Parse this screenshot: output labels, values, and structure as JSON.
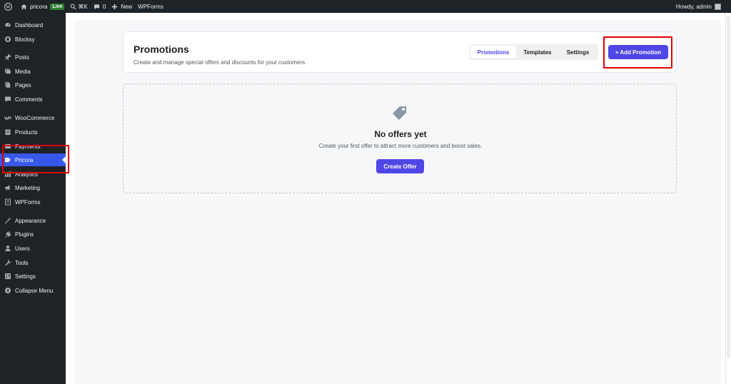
{
  "adminbar": {
    "site_name": "pricora",
    "live_badge": "Live",
    "shortcut": "⌘K",
    "comments_count": "0",
    "new_label": "New",
    "wpforms_label": "WPForms",
    "howdy": "Howdy, admin"
  },
  "sidebar": {
    "items": [
      {
        "label": "Dashboard",
        "icon": "dashboard-icon"
      },
      {
        "label": "Blocksy",
        "icon": "blocksy-icon"
      },
      {
        "label": "Posts",
        "icon": "pin-icon"
      },
      {
        "label": "Media",
        "icon": "media-icon"
      },
      {
        "label": "Pages",
        "icon": "pages-icon"
      },
      {
        "label": "Comments",
        "icon": "comment-icon"
      },
      {
        "label": "WooCommerce",
        "icon": "woo-icon"
      },
      {
        "label": "Products",
        "icon": "archive-icon"
      },
      {
        "label": "Payments",
        "icon": "payments-icon"
      },
      {
        "label": "Pricora",
        "icon": "pricora-icon"
      },
      {
        "label": "Analytics",
        "icon": "analytics-icon"
      },
      {
        "label": "Marketing",
        "icon": "megaphone-icon"
      },
      {
        "label": "WPForms",
        "icon": "forms-icon"
      },
      {
        "label": "Appearance",
        "icon": "brush-icon"
      },
      {
        "label": "Plugins",
        "icon": "plugin-icon"
      },
      {
        "label": "Users",
        "icon": "users-icon"
      },
      {
        "label": "Tools",
        "icon": "wrench-icon"
      },
      {
        "label": "Settings",
        "icon": "settings-icon"
      },
      {
        "label": "Collapse Menu",
        "icon": "collapse-icon"
      }
    ]
  },
  "header": {
    "title": "Promotions",
    "subtitle": "Create and manage special offers and discounts for your customers.",
    "tabs": [
      {
        "label": "Promotions"
      },
      {
        "label": "Templates"
      },
      {
        "label": "Settings"
      }
    ],
    "add_button": "+ Add Promotion"
  },
  "empty_state": {
    "title": "No offers yet",
    "text": "Create your first offer to attract more customers and boost sales.",
    "button": "Create Offer"
  },
  "colors": {
    "accent": "#4f46e5",
    "sidebar_bg": "#1d2327",
    "active_menu": "#3858e9",
    "highlight": "#e00000"
  }
}
